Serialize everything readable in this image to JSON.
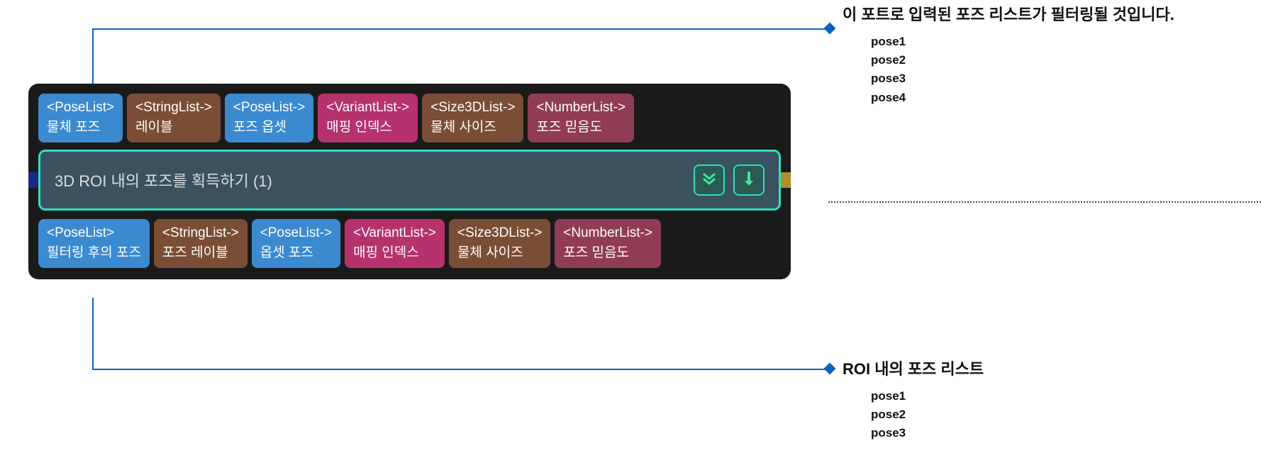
{
  "node": {
    "title": "3D ROI 내의 포즈를 획득하기 (1)",
    "inputs": [
      {
        "type": "<PoseList>",
        "label": "물체 포즈",
        "color": "blue"
      },
      {
        "type": "<StringList->",
        "label": "레이블",
        "color": "brown"
      },
      {
        "type": "<PoseList->",
        "label": "포즈 옵셋",
        "color": "blue"
      },
      {
        "type": "<VariantList->",
        "label": "매핑 인덱스",
        "color": "pink"
      },
      {
        "type": "<Size3DList->",
        "label": "물체 사이즈",
        "color": "brown"
      },
      {
        "type": "<NumberList->",
        "label": "포즈 믿음도",
        "color": "maroon"
      }
    ],
    "outputs": [
      {
        "type": "<PoseList>",
        "label": "필터링 후의 포즈",
        "color": "blue"
      },
      {
        "type": "<StringList->",
        "label": "포즈 레이블",
        "color": "brown"
      },
      {
        "type": "<PoseList->",
        "label": "옵셋 포즈",
        "color": "blue"
      },
      {
        "type": "<VariantList->",
        "label": "매핑 인덱스",
        "color": "pink"
      },
      {
        "type": "<Size3DList->",
        "label": "물체 사이즈",
        "color": "brown"
      },
      {
        "type": "<NumberList->",
        "label": "포즈 믿음도",
        "color": "maroon"
      }
    ]
  },
  "annotations": {
    "top": {
      "title": "이 포트로 입력된 포즈 리스트가 필터링될 것입니다.",
      "items": [
        "pose1",
        "pose2",
        "pose3",
        "pose4"
      ]
    },
    "bottom": {
      "title": "ROI 내의 포즈 리스트",
      "items": [
        "pose1",
        "pose2",
        "pose3"
      ]
    }
  },
  "colors": {
    "blue": "#3b8ad0",
    "brown": "#7a4d36",
    "pink": "#b5326d",
    "maroon": "#8f3c54",
    "line": "#0b62c4",
    "teal": "#2fe0bf"
  }
}
